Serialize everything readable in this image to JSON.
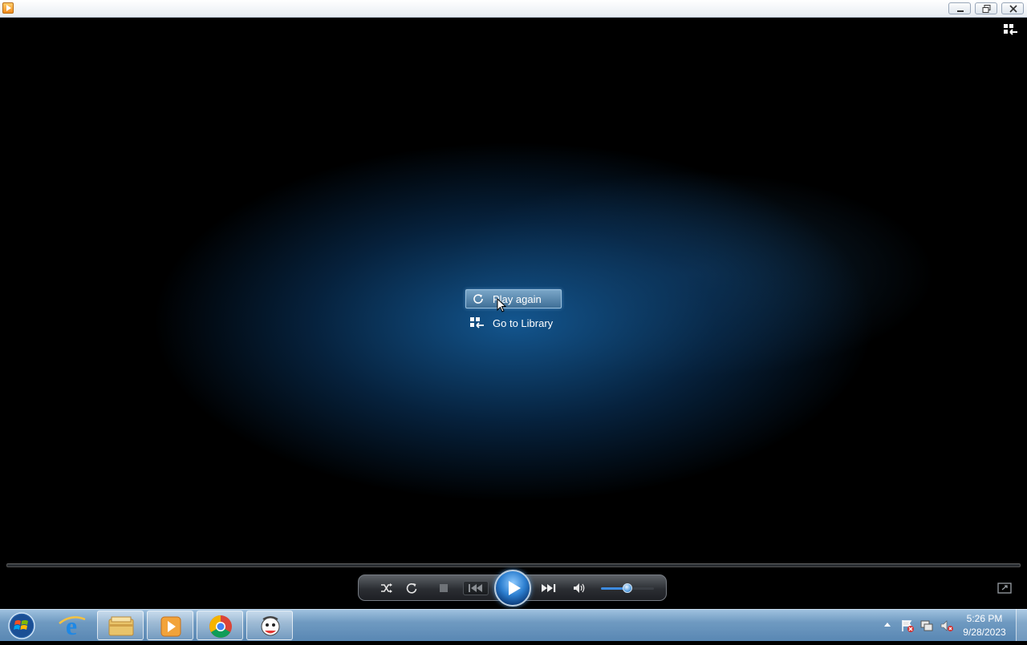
{
  "window": {
    "app_icon": "media-player-icon",
    "minimize_icon": "minimize-icon",
    "restore_icon": "restore-icon",
    "close_icon": "close-icon"
  },
  "overlay": {
    "play_again_label": "Play again",
    "go_library_label": "Go to Library"
  },
  "controls": {
    "shuffle_icon": "shuffle-icon",
    "repeat_icon": "repeat-icon",
    "stop_icon": "stop-icon",
    "previous_icon": "previous-icon",
    "play_icon": "play-icon",
    "next_icon": "next-icon",
    "mute_icon": "speaker-icon",
    "volume_level": 0.5
  },
  "taskbar": {
    "apps": [
      "start-orb",
      "internet-explorer-icon",
      "windows-explorer-icon",
      "windows-media-player-icon",
      "chrome-icon",
      "paint-app-icon"
    ],
    "clock_time": "5:26 PM",
    "clock_date": "9/28/2023"
  },
  "colors": {
    "accent": "#2d7fd0",
    "taskbar": "#6f9ac1"
  }
}
